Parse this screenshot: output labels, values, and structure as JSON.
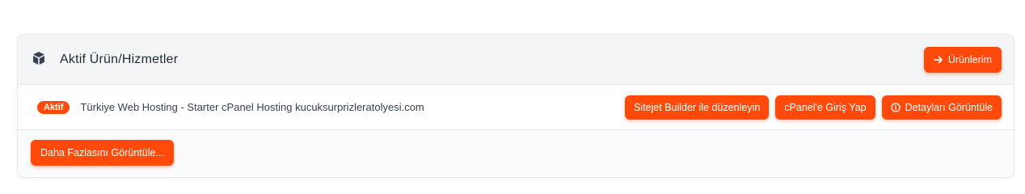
{
  "header": {
    "title": "Aktif Ürün/Hizmetler",
    "products_button": "Ürünlerim",
    "icon": "cube-icon"
  },
  "services": [
    {
      "status": "Aktif",
      "name": "Türkiye Web Hosting - Starter cPanel Hosting kucuksurprizleratolyesi.com",
      "actions": {
        "sitejet": "Sitejet Builder ile düzenleyin",
        "cpanel": "cPanel'e Giriş Yap",
        "details": "Detayları Görüntüle"
      }
    }
  ],
  "footer": {
    "more_button": "Daha Fazlasını Görüntüle..."
  },
  "colors": {
    "accent": "#ff4a0b",
    "header_bg": "#f4f5f7",
    "border": "#e6e8ec"
  }
}
